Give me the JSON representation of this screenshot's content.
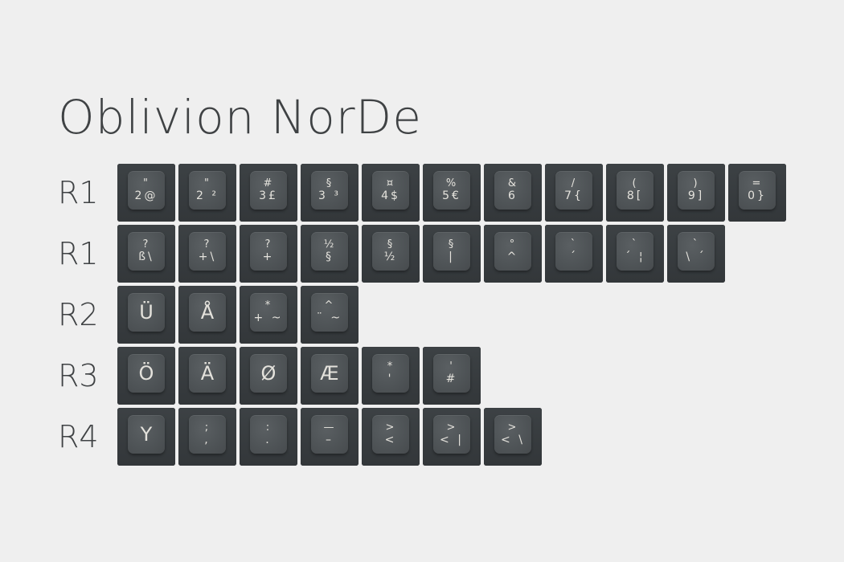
{
  "title": "Oblivion NorDe",
  "rows": [
    {
      "label": "R1",
      "keys": [
        {
          "top": "\"",
          "bottom": "2@"
        },
        {
          "top": "\"",
          "bottom": "2 ²"
        },
        {
          "top": "#",
          "bottom": "3£"
        },
        {
          "top": "§",
          "bottom": "3 ³"
        },
        {
          "top": "¤",
          "bottom": "4$"
        },
        {
          "top": "%",
          "bottom": "5€"
        },
        {
          "top": "&",
          "bottom": "6"
        },
        {
          "top": "/",
          "bottom": "7{"
        },
        {
          "top": "(",
          "bottom": "8["
        },
        {
          "top": ")",
          "bottom": "9]"
        },
        {
          "top": "=",
          "bottom": "0}"
        }
      ]
    },
    {
      "label": "R1",
      "keys": [
        {
          "top": "?",
          "bottom": "ß\\"
        },
        {
          "top": "?",
          "bottom": "+\\"
        },
        {
          "top": "?",
          "bottom": "+"
        },
        {
          "top": "½",
          "bottom": "§"
        },
        {
          "top": "§",
          "bottom": "½"
        },
        {
          "top": "§",
          "bottom": "|"
        },
        {
          "top": "°",
          "bottom": "^"
        },
        {
          "top": "`",
          "bottom": "´"
        },
        {
          "top": "`",
          "bottom": "´ ¦"
        },
        {
          "top": "`",
          "bottom": "\\ ´"
        }
      ]
    },
    {
      "label": "R2",
      "keys": [
        {
          "big": "Ü"
        },
        {
          "big": "Å"
        },
        {
          "top": "*",
          "bottom": "+ ~"
        },
        {
          "top": "^",
          "bottom": "¨ ~"
        }
      ]
    },
    {
      "label": "R3",
      "keys": [
        {
          "big": "Ö"
        },
        {
          "big": "Ä"
        },
        {
          "big": "Ø"
        },
        {
          "big": "Æ"
        },
        {
          "top": "*",
          "bottom": "'"
        },
        {
          "top": "'",
          "bottom": "#"
        }
      ]
    },
    {
      "label": "R4",
      "keys": [
        {
          "big": "Y"
        },
        {
          "top": ";",
          "bottom": ","
        },
        {
          "top": ":",
          "bottom": "."
        },
        {
          "top": "—",
          "bottom": "–"
        },
        {
          "top": ">",
          "bottom": "<"
        },
        {
          "top": ">",
          "bottom": "< |"
        },
        {
          "top": ">",
          "bottom": "< \\"
        }
      ]
    }
  ]
}
